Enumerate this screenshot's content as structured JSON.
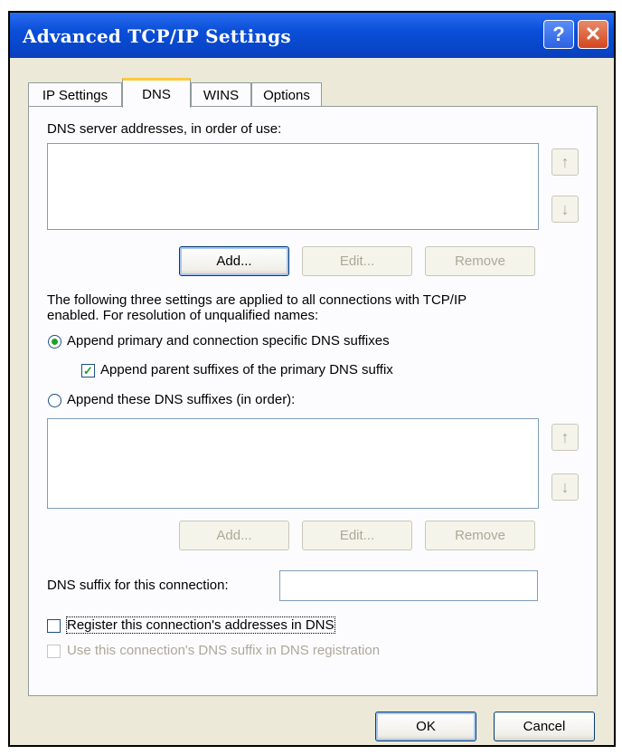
{
  "window": {
    "title": "Advanced TCP/IP Settings",
    "help_label": "?",
    "close_label": "✕"
  },
  "tabs": [
    {
      "label": "IP Settings",
      "active": false
    },
    {
      "label": "DNS",
      "active": true
    },
    {
      "label": "WINS",
      "active": false
    },
    {
      "label": "Options",
      "active": false
    }
  ],
  "dns_servers": {
    "label": "DNS server addresses, in order of use:",
    "items": [],
    "up_icon": "↑",
    "down_icon": "↓",
    "add_label": "Add...",
    "edit_label": "Edit...",
    "remove_label": "Remove"
  },
  "info_text_line1": "The following three settings are applied to all connections with TCP/IP",
  "info_text_line2": "enabled. For resolution of unqualified names:",
  "append_primary": {
    "label": "Append primary and connection specific DNS suffixes",
    "selected": true
  },
  "append_parent": {
    "label": "Append parent suffixes of the primary DNS suffix",
    "checked": true,
    "check_glyph": "✓"
  },
  "append_these": {
    "label": "Append these DNS suffixes (in order):",
    "selected": false,
    "items": [],
    "up_icon": "↑",
    "down_icon": "↓",
    "add_label": "Add...",
    "edit_label": "Edit...",
    "remove_label": "Remove"
  },
  "dns_suffix": {
    "label": "DNS suffix for this connection:",
    "value": ""
  },
  "register": {
    "label": "Register this connection's addresses in DNS",
    "checked": false
  },
  "use_suffix": {
    "label": "Use this connection's DNS suffix in DNS registration",
    "checked": false
  },
  "footer": {
    "ok_label": "OK",
    "cancel_label": "Cancel"
  }
}
